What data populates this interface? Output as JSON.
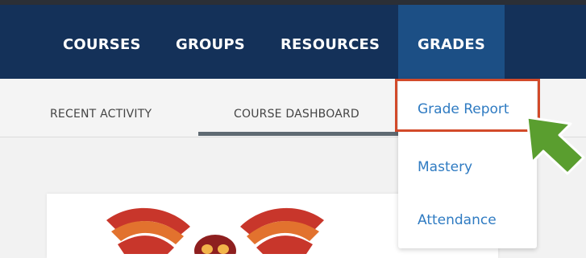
{
  "topnav": {
    "items": [
      {
        "label": "COURSES"
      },
      {
        "label": "GROUPS"
      },
      {
        "label": "RESOURCES"
      },
      {
        "label": "GRADES"
      }
    ],
    "active": "GRADES"
  },
  "subnav": {
    "tabs": [
      {
        "label": "RECENT ACTIVITY"
      },
      {
        "label": "COURSE DASHBOARD"
      }
    ],
    "active": "COURSE DASHBOARD"
  },
  "grades_menu": {
    "items": [
      {
        "label": "Grade Report"
      },
      {
        "label": "Mastery"
      },
      {
        "label": "Attendance"
      }
    ],
    "highlighted": "Grade Report"
  },
  "colors": {
    "nav_bg": "#143159",
    "nav_active_bg": "#1c4f85",
    "link": "#2f7bc2",
    "highlight_box": "#d24a2a",
    "pointer_arrow": "#5a9e2f"
  },
  "icons": {
    "pointer": "green-arrow-icon",
    "logo": "owl-logo-icon"
  }
}
